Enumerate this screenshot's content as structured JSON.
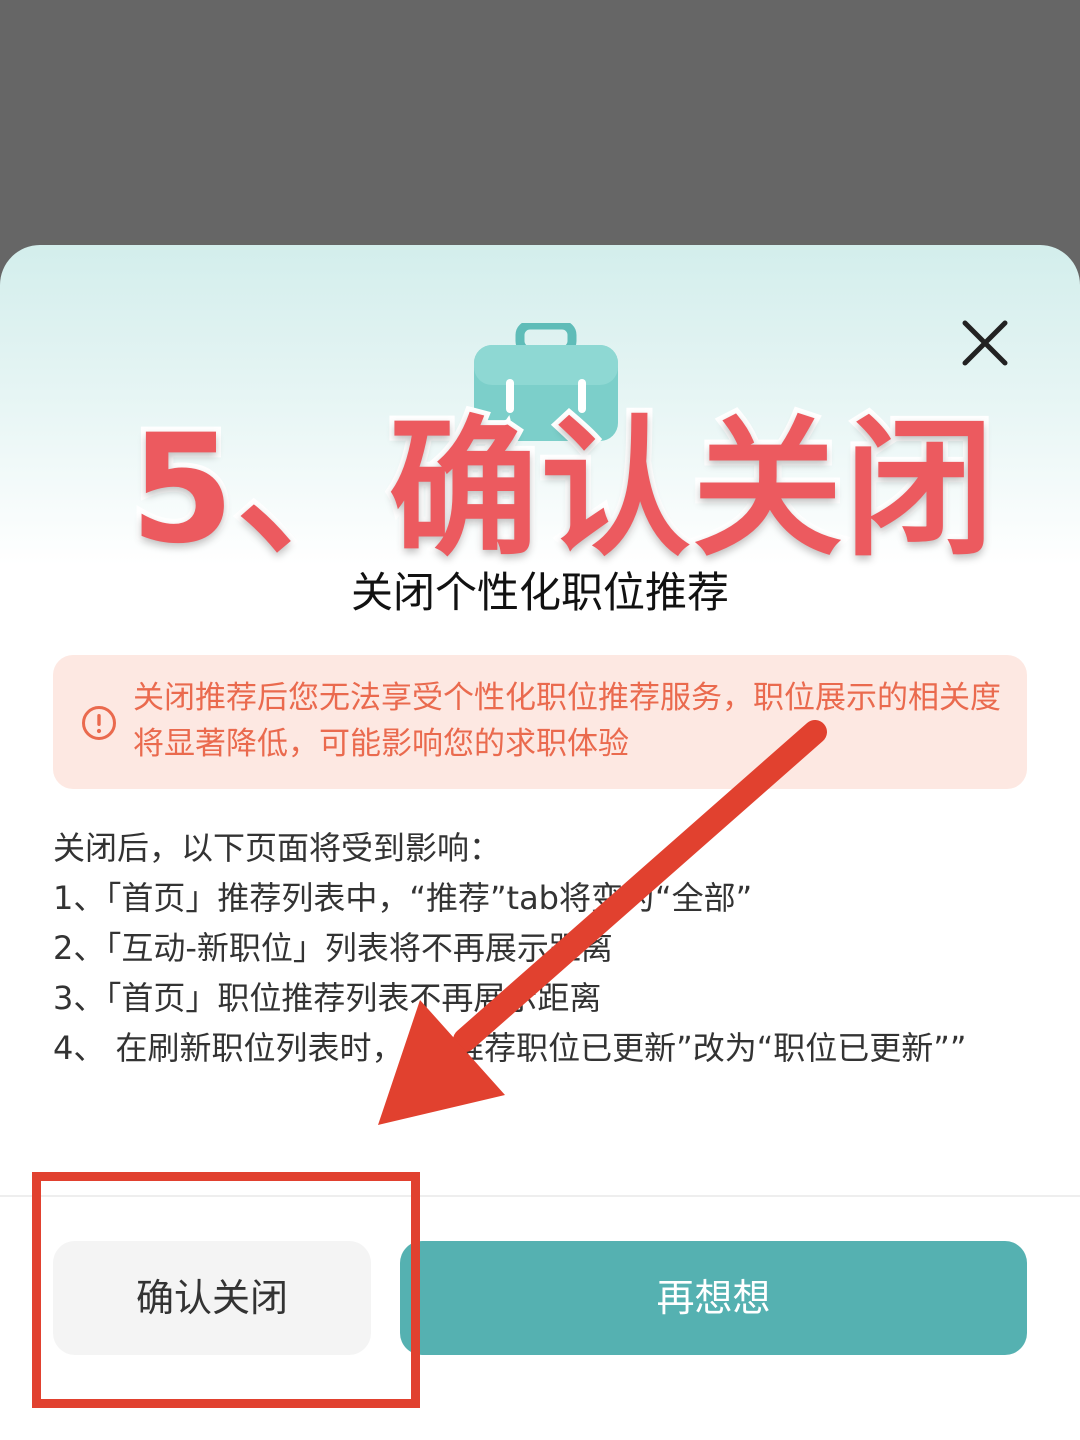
{
  "overlay": {
    "headline": "5、确认关闭"
  },
  "dialog": {
    "title": "关闭个性化职位推荐",
    "warning_text": "关闭推荐后您无法享受个性化职位推荐服务，职位展示的相关度将显著降低，可能影响您的求职体验",
    "impact_heading": "关闭后，以下页面将受到影响：",
    "impact_items": [
      "1、「首页」推荐列表中，“推荐”tab将变为“全部”",
      "2、「互动-新职位」列表将不再展示距离",
      "3、「首页」职位推荐列表不再展示距离",
      "4、 在刷新职位列表时，由“推荐职位已更新”改为“职位已更新””"
    ],
    "confirm_label": "确认关闭",
    "rethink_label": "再想想"
  },
  "icons": {
    "close": "close-icon",
    "warning": "warning-circle-icon",
    "briefcase": "briefcase-icon"
  },
  "colors": {
    "accent": "#55b1b1",
    "warning_text": "#ea6a4e",
    "warning_bg": "#fde8e2",
    "annotation_red": "#e1412f",
    "headline_red": "#ec5a5f"
  }
}
